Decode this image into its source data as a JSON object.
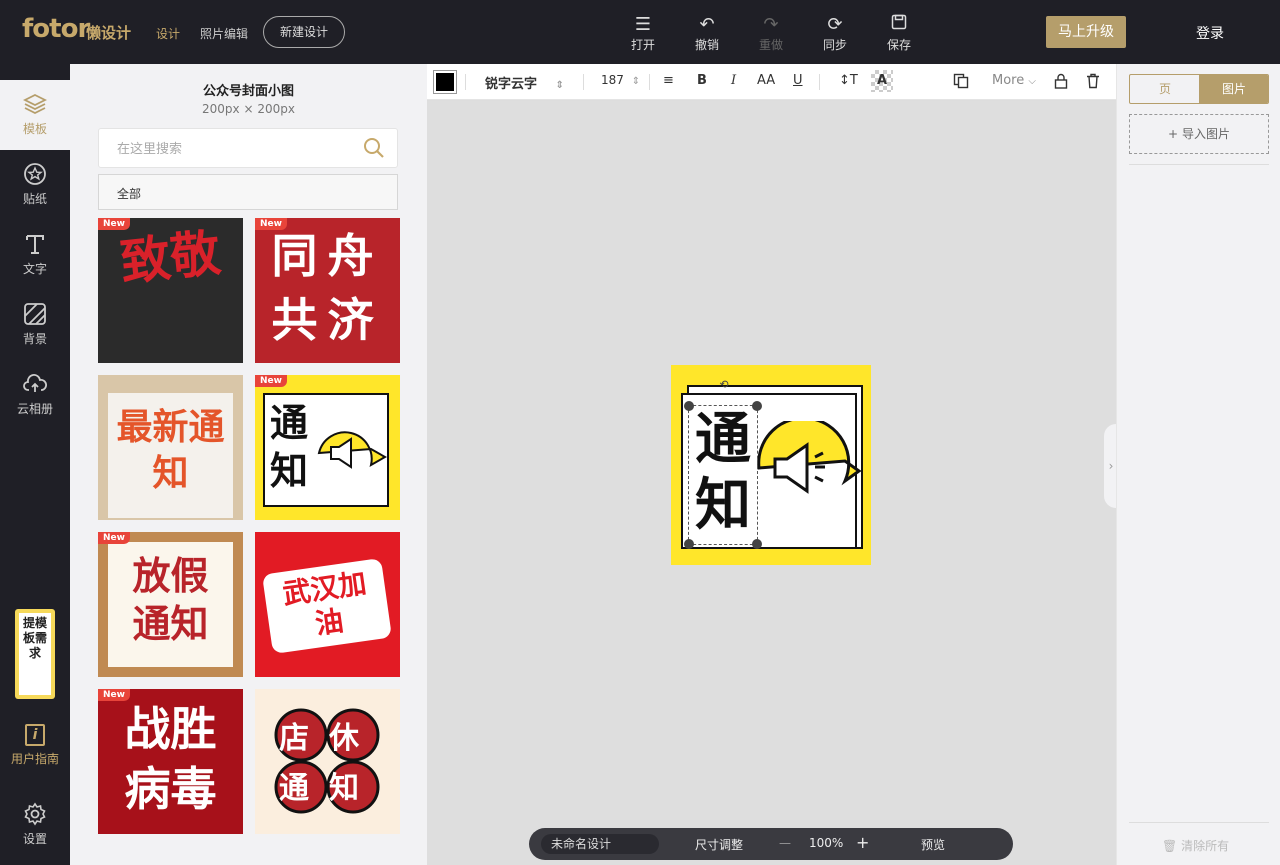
{
  "header": {
    "logo": "fotor",
    "logo_sub": "懒设计",
    "nav": [
      "设计",
      "照片编辑"
    ],
    "new_design": "新建设计",
    "tools": [
      {
        "label": "打开",
        "icon": "menu-icon"
      },
      {
        "label": "撤销",
        "icon": "undo-icon"
      },
      {
        "label": "重做",
        "icon": "redo-icon"
      },
      {
        "label": "同步",
        "icon": "sync-icon"
      },
      {
        "label": "保存",
        "icon": "save-icon"
      }
    ],
    "upgrade": "马上升级",
    "login": "登录"
  },
  "sidebar": {
    "items": [
      {
        "label": "模板",
        "icon": "layers-icon"
      },
      {
        "label": "贴纸",
        "icon": "star-circle-icon"
      },
      {
        "label": "文字",
        "icon": "text-t-icon"
      },
      {
        "label": "背景",
        "icon": "pattern-icon"
      },
      {
        "label": "云相册",
        "icon": "cloud-upload-icon"
      }
    ],
    "request": "提模板需求",
    "guide": "用户指南",
    "settings": "设置"
  },
  "panel": {
    "title": "公众号封面小图",
    "size": "200px × 200px",
    "search_placeholder": "在这里搜索",
    "filter_value": "全部",
    "new_badge": "New",
    "templates": [
      {
        "text": "致敬",
        "new": true
      },
      {
        "text": "同舟共济",
        "new": true
      },
      {
        "text": "最新通知",
        "new": false
      },
      {
        "text": "通知",
        "new": true
      },
      {
        "text": "放假通知",
        "new": true
      },
      {
        "text": "武汉加油",
        "new": false
      },
      {
        "text": "战胜病毒",
        "new": true
      },
      {
        "text": "店休通知",
        "new": false
      }
    ]
  },
  "toolbar": {
    "color": "#000000",
    "font": "锐字云字",
    "font_size": "187",
    "bold": "B",
    "italic": "I",
    "case": "AA",
    "underline": "U",
    "more": "More"
  },
  "canvas": {
    "text": "通知"
  },
  "right": {
    "tab_page": "页",
    "tab_image": "图片",
    "import": "导入图片",
    "clear": "清除所有"
  },
  "bottom": {
    "name": "未命名设计",
    "resize": "尺寸调整",
    "minus": "—",
    "zoom": "100%",
    "plus": "+",
    "preview": "预览"
  }
}
